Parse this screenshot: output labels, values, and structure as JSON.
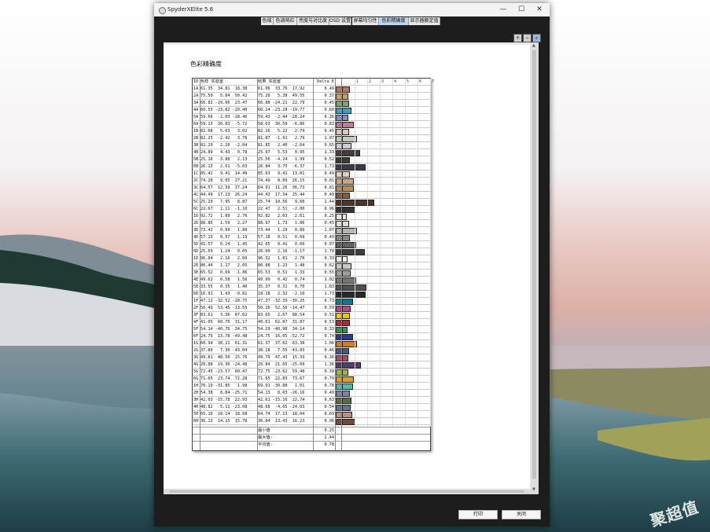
{
  "window": {
    "title": "SpyderXElite 5.6",
    "minimize": "—",
    "maximize": "☐",
    "close": "✕"
  },
  "watermark": "聚超值",
  "tabs": [
    {
      "label": "色域"
    },
    {
      "label": "色调响应"
    },
    {
      "label": "亮度与对比度"
    },
    {
      "label": "OSD 设置"
    },
    {
      "label": "屏幕均匀性"
    },
    {
      "label": "色彩精确度",
      "active": true
    },
    {
      "label": "显示器额定值"
    }
  ],
  "toolbar": {
    "zoom_in": "+",
    "zoom_out": "−",
    "zoom_fit": "⌕"
  },
  "report": {
    "title": "色彩精确度"
  },
  "table": {
    "h_id": "ID",
    "h_ref": "色样 实验室",
    "h_meas": "结果 实验室",
    "h_de": "Delta E",
    "ticks": [
      "1",
      "2",
      "3",
      "4",
      "5",
      "6",
      "7"
    ],
    "rows": [
      {
        "id": "1A",
        "ref": "61.35  34.81  18.38",
        "meas": "61.06  33.76  17.92",
        "de": "0.49",
        "color": "#b57562"
      },
      {
        "id": "2A",
        "ref": "75.50   5.84  50.42",
        "meas": "75.20   5.38  49.55",
        "de": "0.37",
        "color": "#c6a160"
      },
      {
        "id": "3A",
        "ref": "66.82 -29.06  23.47",
        "meas": "66.88 -24.21  22.79",
        "de": "0.45",
        "color": "#7ea56f"
      },
      {
        "id": "4A",
        "ref": "60.53 -23.82 -20.40",
        "meas": "60.24 -23.28 -19.77",
        "de": "0.60",
        "color": "#4a9bb7"
      },
      {
        "id": "5A",
        "ref": "59.66  -2.03 -28.46",
        "meas": "59.43  -2.44 -28.24",
        "de": "0.36",
        "color": "#7f8fc2"
      },
      {
        "id": "6A",
        "ref": "59.13  30.83  -5.72",
        "meas": "58.63  30.59  -6.86",
        "de": "0.83",
        "color": "#b67f96"
      },
      {
        "id": "1B",
        "ref": "82.68   5.03   3.02",
        "meas": "82.26   5.22   2.74",
        "de": "0.45",
        "color": "#d9c7c4"
      },
      {
        "id": "2B",
        "ref": "82.25  -2.42   3.78",
        "meas": "81.87  -1.91   2.79",
        "de": "1.07",
        "color": "#c7c9c0"
      },
      {
        "id": "3B",
        "ref": "82.29   2.20  -2.04",
        "meas": "81.85   2.40  -2.64",
        "de": "0.65",
        "color": "#cccbd0"
      },
      {
        "id": "4B",
        "ref": "24.89   4.43   0.78",
        "meas": "25.97   5.53   0.95",
        "de": "1.33",
        "color": "#463e3b"
      },
      {
        "id": "5B",
        "ref": "25.16  -3.88   2.13",
        "meas": "25.56  -4.24   1.99",
        "de": "0.52",
        "color": "#363b35"
      },
      {
        "id": "6B",
        "ref": "26.13   2.61  -5.03",
        "meas": "26.84   3.75  -6.37",
        "de": "1.73",
        "color": "#3a3b47"
      },
      {
        "id": "1C",
        "ref": "85.42   9.41  14.49",
        "meas": "85.63   9.41  13.81",
        "de": "0.49",
        "color": "#e6cdbe"
      },
      {
        "id": "2C",
        "ref": "74.28   9.05  27.21",
        "meas": "74.49   8.89  26.15",
        "de": "0.81",
        "color": "#c5a88b"
      },
      {
        "id": "3C",
        "ref": "64.57  12.39  37.24",
        "meas": "64.91  11.26  36.73",
        "de": "0.81",
        "color": "#b58e5e"
      },
      {
        "id": "4C",
        "ref": "44.49  17.23  26.24",
        "meas": "44.43  17.34  25.44",
        "de": "0.49",
        "color": "#825b46"
      },
      {
        "id": "5C",
        "ref": "25.29   7.95   8.87",
        "meas": "25.74  10.56   9.60",
        "de": "2.44",
        "color": "#4a352d"
      },
      {
        "id": "6C",
        "ref": "22.67   2.11  -1.10",
        "meas": "22.47   2.51  -2.00",
        "de": "0.96",
        "color": "#383434"
      },
      {
        "id": "1D",
        "ref": "92.72   1.89   2.76",
        "meas": "92.82   2.03   2.61",
        "de": "0.25",
        "color": "#ebe8e5"
      },
      {
        "id": "2D",
        "ref": "88.85   1.59   2.27",
        "meas": "88.97   1.73   1.86",
        "de": "0.45",
        "color": "#dfdcd9"
      },
      {
        "id": "3D",
        "ref": "73.42   0.99   1.89",
        "meas": "73.44   1.29   0.89",
        "de": "1.07",
        "color": "#b7b4b1"
      },
      {
        "id": "4D",
        "ref": "57.15   0.57   1.19",
        "meas": "57.18   0.51   0.69",
        "de": "0.49",
        "color": "#8b8986"
      },
      {
        "id": "5D",
        "ref": "41.57   0.24   1.45",
        "meas": "42.05   0.41   0.60",
        "de": "0.97",
        "color": "#63615e"
      },
      {
        "id": "6D",
        "ref": "25.65   1.24   0.05",
        "meas": "26.09   2.16  -1.17",
        "de": "1.70",
        "color": "#3e3d3d"
      },
      {
        "id": "1E",
        "ref": "96.04   2.16   2.60",
        "meas": "96.32   1.81   2.70",
        "de": "0.33",
        "color": "#f5f2ef"
      },
      {
        "id": "2E",
        "ref": "80.44   1.17   2.05",
        "meas": "80.88   1.23   1.48",
        "de": "0.62",
        "color": "#cac7c4"
      },
      {
        "id": "3E",
        "ref": "65.52   0.69   1.86",
        "meas": "65.53   0.51   1.33",
        "de": "0.55",
        "color": "#a19e9b"
      },
      {
        "id": "4E",
        "ref": "49.62   0.58   1.56",
        "meas": "49.99   0.42   0.74",
        "de": "1.02",
        "color": "#787673"
      },
      {
        "id": "5E",
        "ref": "33.55   0.35   1.40",
        "meas": "35.37   0.31   0.70",
        "de": "1.83",
        "color": "#51504e"
      },
      {
        "id": "6E",
        "ref": "16.91   1.43  -0.81",
        "meas": "18.18   2.32  -2.10",
        "de": "1.73",
        "color": "#2a292a"
      },
      {
        "id": "1F",
        "ref": "47.12 -32.52 -28.75",
        "meas": "47.37 -32.39 -30.25",
        "de": "0.73",
        "color": "#007c8d"
      },
      {
        "id": "2F",
        "ref": "50.49  53.45 -13.55",
        "meas": "50.26  52.56 -14.47",
        "de": "0.59",
        "color": "#b8448a"
      },
      {
        "id": "3F",
        "ref": "83.61   3.36  87.02",
        "meas": "83.65   2.67  88.54",
        "de": "0.51",
        "color": "#e5c800"
      },
      {
        "id": "4F",
        "ref": "41.05  60.75  31.17",
        "meas": "40.61  62.07  31.87",
        "de": "0.53",
        "color": "#ac2c33"
      },
      {
        "id": "5F",
        "ref": "54.14 -40.76  34.75",
        "meas": "54.29 -40.98  34.14",
        "de": "0.33",
        "color": "#35944e"
      },
      {
        "id": "6F",
        "ref": "24.75  13.78 -49.48",
        "meas": "24.75  16.05 -52.72",
        "de": "0.74",
        "color": "#2b3a8e"
      },
      {
        "id": "1G",
        "ref": "60.94  38.21  61.31",
        "meas": "61.37  37.62  63.38",
        "de": "1.06",
        "color": "#d27b2d"
      },
      {
        "id": "2G",
        "ref": "37.80   7.30 -43.04",
        "meas": "38.28   7.55 -43.83",
        "de": "0.46",
        "color": "#4c5391"
      },
      {
        "id": "3G",
        "ref": "49.81  48.50  15.76",
        "meas": "49.79  47.43  15.33",
        "de": "0.36",
        "color": "#b04a62"
      },
      {
        "id": "4G",
        "ref": "28.88  19.36 -24.48",
        "meas": "29.84  21.65 -25.69",
        "de": "1.36",
        "color": "#513f6b"
      },
      {
        "id": "5G",
        "ref": "72.45 -23.57  60.47",
        "meas": "72.75 -23.62  59.48",
        "de": "0.39",
        "color": "#9fb53e"
      },
      {
        "id": "6G",
        "ref": "71.65  23.74  72.28",
        "meas": "71.65  22.83  73.67",
        "de": "0.79",
        "color": "#e29c25"
      },
      {
        "id": "1H",
        "ref": "70.19 -31.85   1.98",
        "meas": "69.91 -30.88   1.01",
        "de": "0.78",
        "color": "#5cb8a7"
      },
      {
        "id": "2H",
        "ref": "54.38   8.84 -25.71",
        "meas": "54.13   8.63 -26.16",
        "de": "0.49",
        "color": "#7d81ae"
      },
      {
        "id": "3H",
        "ref": "42.03 -15.78  22.93",
        "meas": "42.61 -15.16  22.74",
        "de": "0.63",
        "color": "#5b6d45"
      },
      {
        "id": "4H",
        "ref": "48.82  -5.11 -23.08",
        "meas": "48.68  -4.65 -24.03",
        "de": "0.54",
        "color": "#617594"
      },
      {
        "id": "5H",
        "ref": "65.10  18.14  18.68",
        "meas": "64.74  17.13  18.04",
        "de": "0.69",
        "color": "#c18f7e"
      },
      {
        "id": "6H",
        "ref": "36.13  14.15  15.78",
        "meas": "36.84  13.43  16.23",
        "de": "0.96",
        "color": "#6a4d3f"
      }
    ],
    "summary": [
      {
        "label": "最小值",
        "value": "0.25"
      },
      {
        "label": "最大值:",
        "value": "2.44"
      },
      {
        "label": "平均值:",
        "value": "0.78"
      }
    ]
  },
  "buttons": {
    "print": "打印",
    "close": "关闭"
  }
}
